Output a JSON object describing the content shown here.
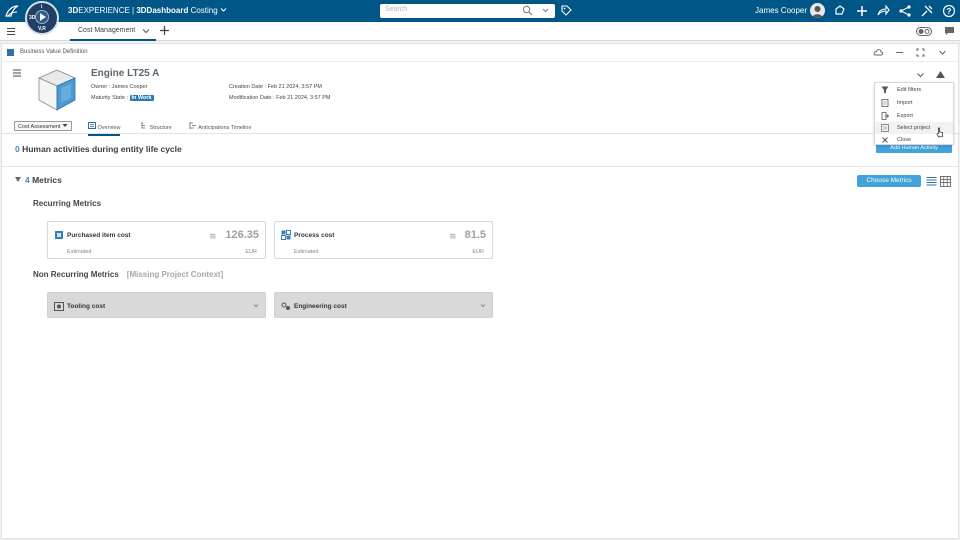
{
  "topbar": {
    "brand_bold": "3D",
    "brand_rest": "EXPERIENCE | ",
    "dashboard_bold": "3DDashboard",
    "app_name": "Costing",
    "search_placeholder": "Search",
    "user_name": "James Cooper",
    "compass_labels": [
      "3D",
      "V,R",
      "i"
    ],
    "icons": [
      "ds-logo-icon",
      "compass-icon",
      "search-icon",
      "chevron-down-icon",
      "tag-icon",
      "avatar",
      "notification-icon",
      "plus-icon",
      "share-icon",
      "network-icon",
      "tools-icon",
      "help-icon"
    ]
  },
  "tabbar": {
    "active_tab": "Cost Management",
    "icons": [
      "menu-icon",
      "chevron-down-icon",
      "add-tab-icon",
      "toggle-icon",
      "chat-icon"
    ]
  },
  "widget": {
    "title": "Business Value Definition",
    "header_icons": [
      "cloud-icon",
      "minimize-icon",
      "maximize-icon",
      "chevron-down-icon"
    ]
  },
  "object": {
    "title": "Engine LT25 A",
    "owner_label": "Owner : ",
    "owner": "James Cooper",
    "maturity_label": "Maturity State : ",
    "maturity": "In Work",
    "creation_label": "Creation Date : ",
    "creation": "Feb 21 2024, 3:57 PM",
    "modification_label": "Modification Date : ",
    "modification": "Feb 21 2024, 3:57 PM"
  },
  "subtabs": {
    "dropdown": "Cost Assessment",
    "tabs": [
      "Overview",
      "Structure",
      "Anticipations Timeline"
    ],
    "active": "Overview"
  },
  "human": {
    "count": "0",
    "label": " Human activities during entity life cycle",
    "add_button": "Add Human Activity"
  },
  "metrics": {
    "count": "4",
    "label": " Metrics",
    "choose_button": "Choose Metrics",
    "recurring_title": "Recurring Metrics",
    "recurring": [
      {
        "name": "Purchased item cost",
        "approx": "≊",
        "value": "126.35",
        "status": "Estimated",
        "unit": "EUR"
      },
      {
        "name": "Process cost",
        "approx": "≊",
        "value": "81.5",
        "status": "Estimated",
        "unit": "EUR"
      }
    ],
    "non_recurring_title": "Non Recurring Metrics",
    "missing_context": "[Missing Project Context]",
    "non_recurring": [
      {
        "name": "Tooling cost"
      },
      {
        "name": "Engineering cost"
      }
    ]
  },
  "menu": {
    "items": [
      "Edit filters",
      "Import",
      "Export",
      "Select project",
      "Close"
    ],
    "hovered": "Select project"
  },
  "colors": {
    "topbar": "#005686",
    "accent": "#42a2da",
    "badge": "#2b7bb0"
  }
}
